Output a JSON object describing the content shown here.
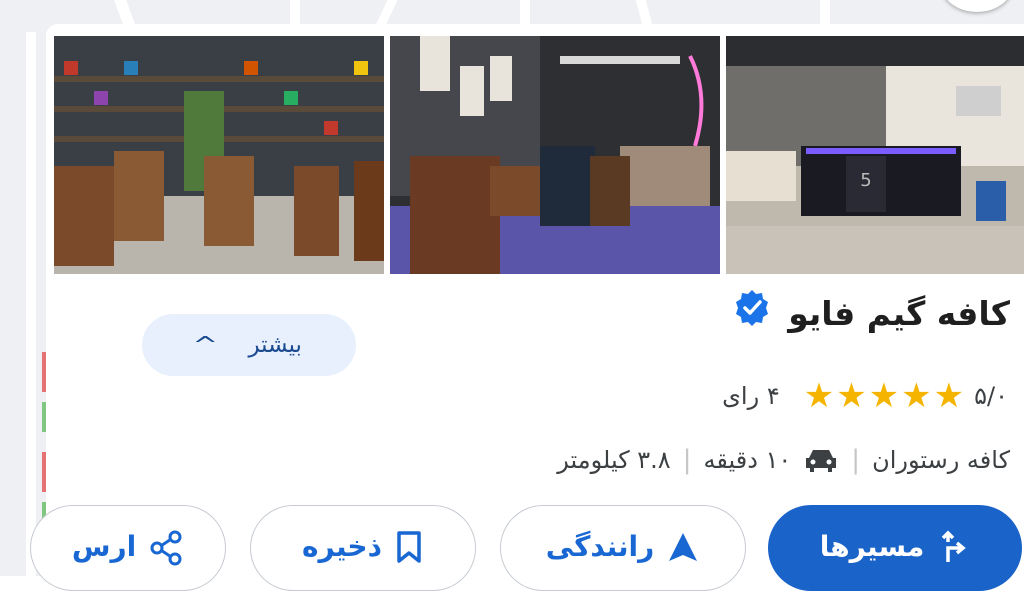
{
  "place": {
    "name": "کافه گیم فایو",
    "verified": true,
    "rating": "۵/۰",
    "stars": 5,
    "reviews_label": "۴ رای",
    "category": "کافه رستوران",
    "drive_time": "۱۰ دقیقه",
    "distance": "۳.۸ کیلومتر"
  },
  "more_button": {
    "label": "بیشتر"
  },
  "actions": {
    "directions": "مسیرها",
    "drive": "رانندگی",
    "save": "ذخیره",
    "share": "ارس"
  },
  "photos": [
    {
      "description": "cafe-interior-shelves"
    },
    {
      "description": "cafe-seating-neon"
    },
    {
      "description": "cafe-counter"
    }
  ],
  "colors": {
    "accent": "#1a63c9",
    "accent_light": "#e8f0fe",
    "star": "#f4b400",
    "verified": "#1a73e8"
  }
}
